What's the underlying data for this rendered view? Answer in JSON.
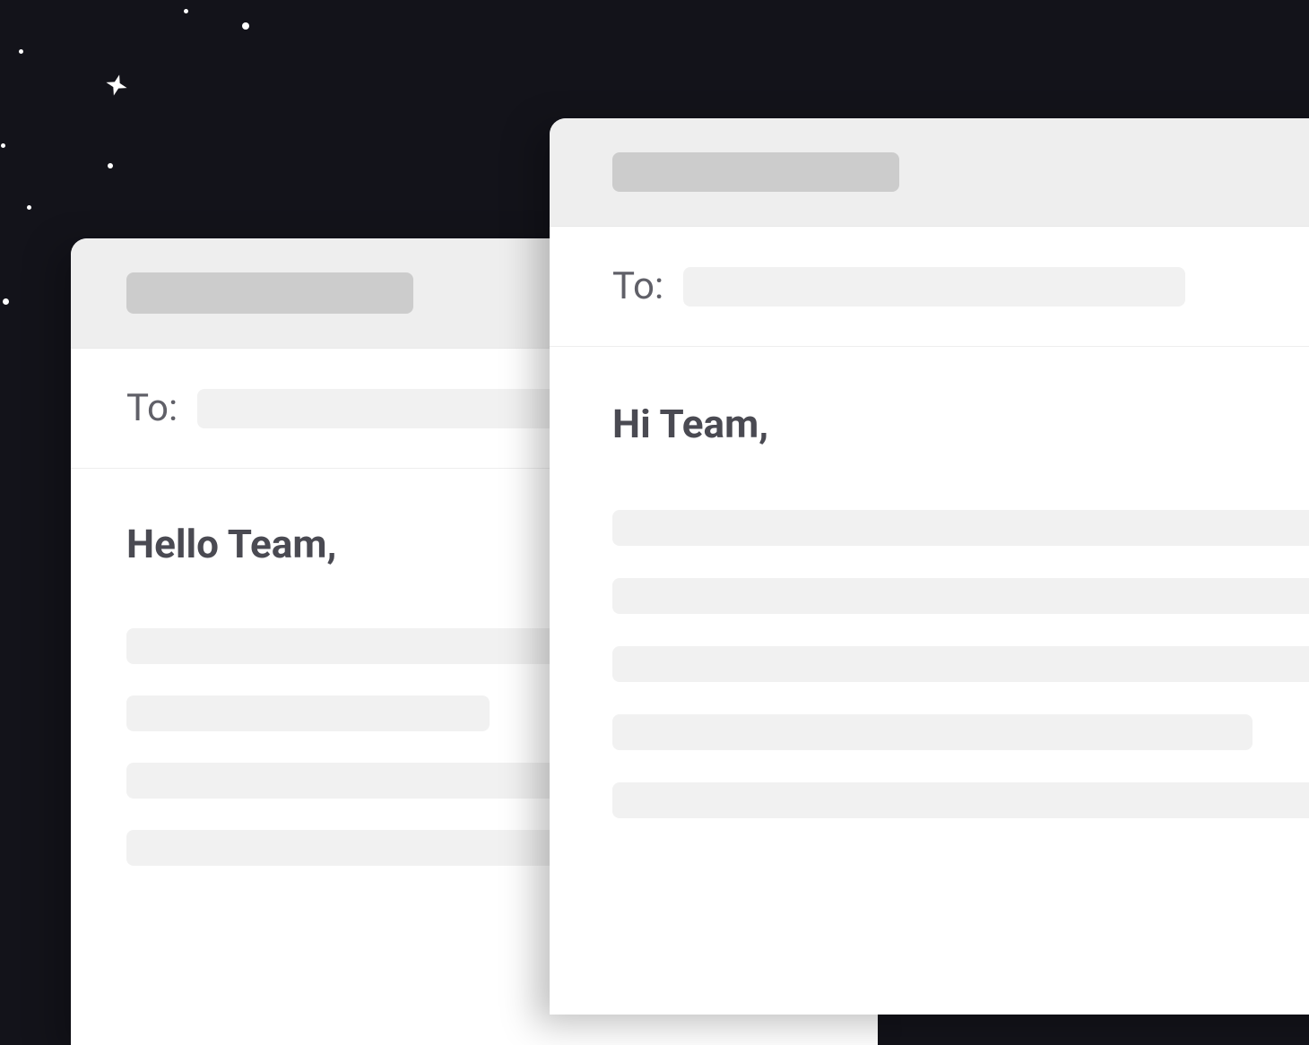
{
  "decoration": {
    "theme": "dark-space"
  },
  "emails": {
    "back": {
      "to_label": "To:",
      "greeting": "Hello Team,"
    },
    "front": {
      "to_label": "To:",
      "greeting": "Hi Team,"
    }
  }
}
